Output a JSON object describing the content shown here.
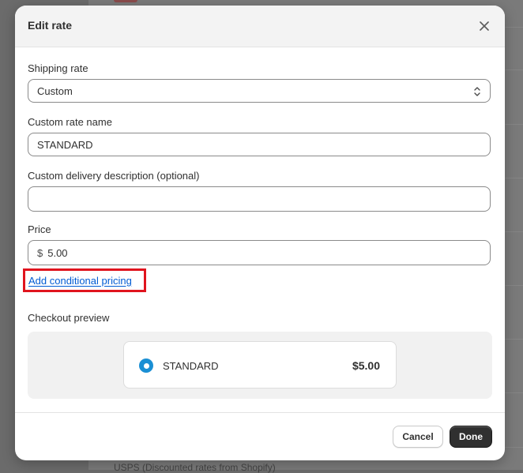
{
  "background": {
    "footer_text": "USPS (Discounted rates from Shopify)"
  },
  "modal": {
    "title": "Edit rate",
    "close_icon": "close-icon"
  },
  "form": {
    "shipping_rate": {
      "label": "Shipping rate",
      "value": "Custom",
      "icon": "select-arrows-icon"
    },
    "custom_rate_name": {
      "label": "Custom rate name",
      "value": "STANDARD"
    },
    "custom_delivery_description": {
      "label": "Custom delivery description (optional)",
      "value": ""
    },
    "price": {
      "label": "Price",
      "prefix": "$",
      "value": "5.00"
    },
    "conditional_pricing_link": "Add conditional pricing",
    "highlight_color": "#e0141e"
  },
  "checkout_preview": {
    "label": "Checkout preview",
    "rate_name": "STANDARD",
    "rate_price": "$5.00",
    "selected": true,
    "radio_color": "#1a8fd4"
  },
  "footer": {
    "cancel_label": "Cancel",
    "done_label": "Done"
  }
}
